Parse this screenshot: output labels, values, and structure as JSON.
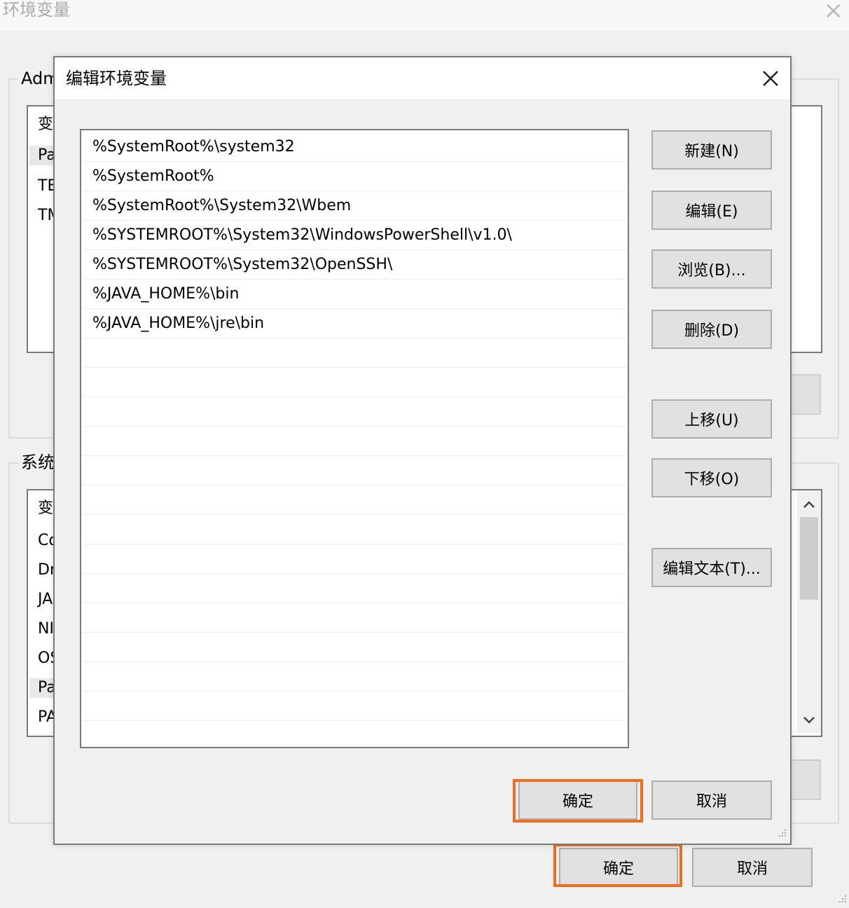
{
  "parent_window": {
    "title": "环境变量",
    "close_glyph": "×",
    "user_section": {
      "label": "Adm",
      "rows": [
        "变",
        "Pa",
        "TE",
        "TM"
      ]
    },
    "system_section": {
      "label": "系统",
      "rows": [
        "变",
        "Co",
        "Dr",
        "JA",
        "NI",
        "OS",
        "Pa",
        "PA"
      ]
    },
    "ok_label": "确定",
    "cancel_label": "取消"
  },
  "dialog": {
    "title": "编辑环境变量",
    "close_glyph": "✕",
    "paths": [
      "%SystemRoot%\\system32",
      "%SystemRoot%",
      "%SystemRoot%\\System32\\Wbem",
      "%SYSTEMROOT%\\System32\\WindowsPowerShell\\v1.0\\",
      "%SYSTEMROOT%\\System32\\OpenSSH\\",
      "%JAVA_HOME%\\bin",
      "%JAVA_HOME%\\jre\\bin"
    ],
    "buttons": {
      "new": "新建(N)",
      "edit": "编辑(E)",
      "browse": "浏览(B)...",
      "delete": "删除(D)",
      "move_up": "上移(U)",
      "move_down": "下移(O)",
      "edit_text": "编辑文本(T)..."
    },
    "ok_label": "确定",
    "cancel_label": "取消"
  },
  "colors": {
    "highlight": "#f26d16",
    "button_bg": "#e1e1e1",
    "window_bg": "#f0f0f0"
  },
  "icons": {
    "scroll_up": "⌃",
    "scroll_down": "⌄",
    "resize_grip": "⋰"
  }
}
